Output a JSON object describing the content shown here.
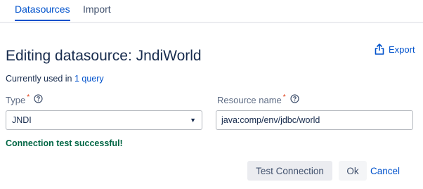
{
  "tabs": [
    {
      "label": "Datasources",
      "active": true
    },
    {
      "label": "Import",
      "active": false
    }
  ],
  "header": {
    "title": "Editing datasource: JndiWorld",
    "export_label": "Export",
    "export_icon": "export-icon"
  },
  "usage": {
    "prefix": "Currently used in",
    "link": "1 query"
  },
  "fields": {
    "type": {
      "label": "Type",
      "required_mark": "*",
      "help_icon": "question-circle-icon",
      "value": "JNDI"
    },
    "resource_name": {
      "label": "Resource name",
      "required_mark": "*",
      "help_icon": "question-circle-icon",
      "value": "java:comp/env/jdbc/world"
    }
  },
  "status": {
    "message": "Connection test successful!",
    "color": "#006644"
  },
  "actions": {
    "test_label": "Test Connection",
    "ok_label": "Ok",
    "cancel_label": "Cancel"
  },
  "colors": {
    "accent": "#0052cc",
    "text": "#172b4d",
    "required": "#de350b"
  }
}
